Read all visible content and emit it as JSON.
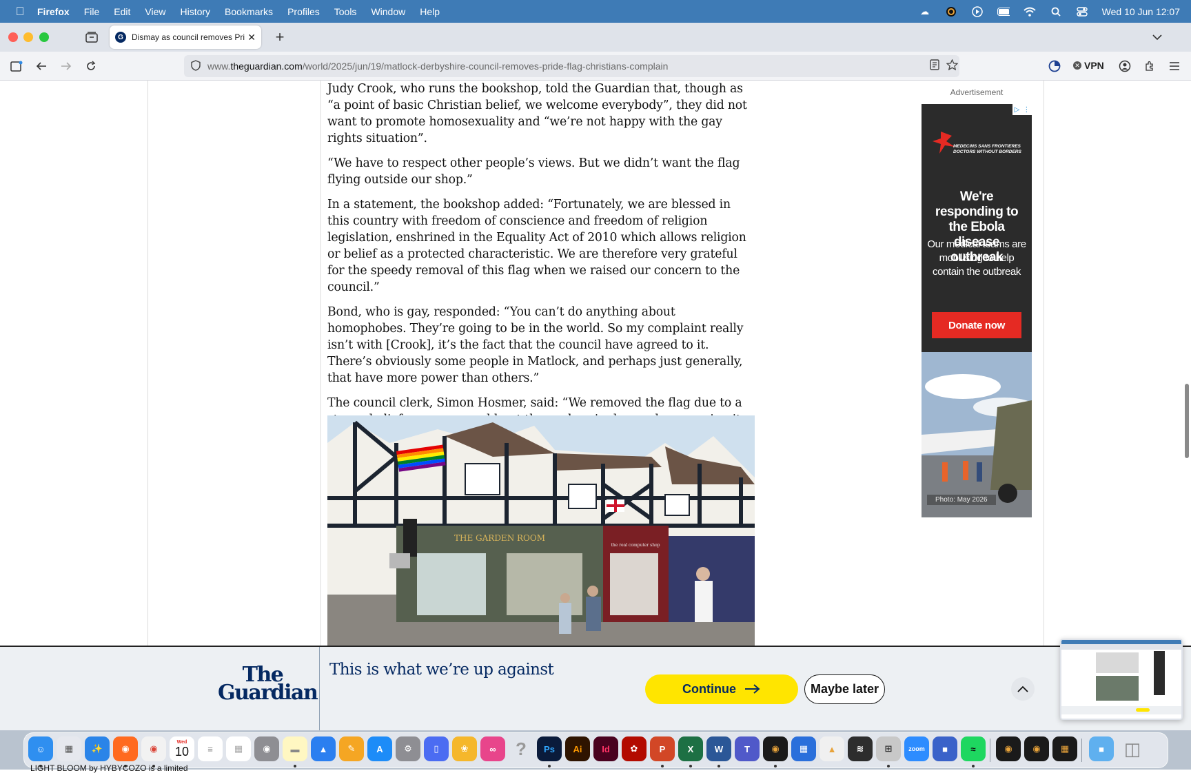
{
  "menubar": {
    "app_name": "Firefox",
    "items": [
      "File",
      "Edit",
      "View",
      "History",
      "Bookmarks",
      "Profiles",
      "Tools",
      "Window",
      "Help"
    ],
    "clock": "Wed 10 Jun  12:07"
  },
  "browser": {
    "tab_title": "Dismay as council removes Pride",
    "url_prefix": "www.",
    "url_domain": "theguardian.com",
    "url_path": "/world/2025/jun/19/matlock-derbyshire-council-removes-pride-flag-christians-complain",
    "vpn_label": "VPN"
  },
  "article": {
    "paragraphs": [
      "Judy Crook, who runs the bookshop, told the Guardian that, though as “a point of basic Christian belief, we welcome everybody”, they did not want to promote homosexuality and “we’re not happy with the gay rights situation”.",
      "“We have to respect other people’s views. But we didn’t want the flag flying outside our shop.”",
      "In a statement, the bookshop added: “Fortunately, we are blessed in this country with freedom of conscience and freedom of religion legislation, enshrined in the Equality Act of 2010 which allows religion or belief as a protected characteristic. We are therefore very grateful for the speedy removal of this flag when we raised our concern to the council.”",
      "Bond, who is gay, responded: “You can’t do anything about homophobes. They’re going to be in the world. So my complaint really isn’t with [Crook], it’s the fact that the council have agreed to it. There’s obviously some people in Matlock, and perhaps just generally, that have more power than others.”",
      "The council clerk, Simon Hosmer, said: “We removed the flag due to a strong belief someone would put themselves in danger by removing it themselves. As a town council we can ill afford damage to property let alone damage to a person that we may be liable for.”"
    ],
    "photo_shop_sign": "THE GARDEN ROOM",
    "photo_shop_sign_2": "the real computer shop"
  },
  "advert": {
    "label": "Advertisement",
    "org": "MEDECINS SANS FRONTIERES DOCTORS WITHOUT BORDERS",
    "headline": "We're responding to the Ebola disease outbreak",
    "subline": "Our medical teams are mobilising to help contain the outbreak",
    "cta": "Donate now",
    "credit": "Photo: May 2026"
  },
  "banner": {
    "logo_line1": "The",
    "logo_line2": "Guardian",
    "heading": "This is what we’re up against",
    "continue_label": "Continue",
    "later_label": "Maybe later"
  },
  "dock": {
    "calendar_month": "Wed",
    "calendar_day": "10",
    "zoom_label": "zoom",
    "desktop_text": "LIGHT BLOOM by HYBYCOZO is a limited"
  },
  "colors": {
    "menubar": "#3e7bb6",
    "guardian_blue": "#052962",
    "cta_yellow": "#ffe500",
    "msf_red": "#e52a23"
  }
}
